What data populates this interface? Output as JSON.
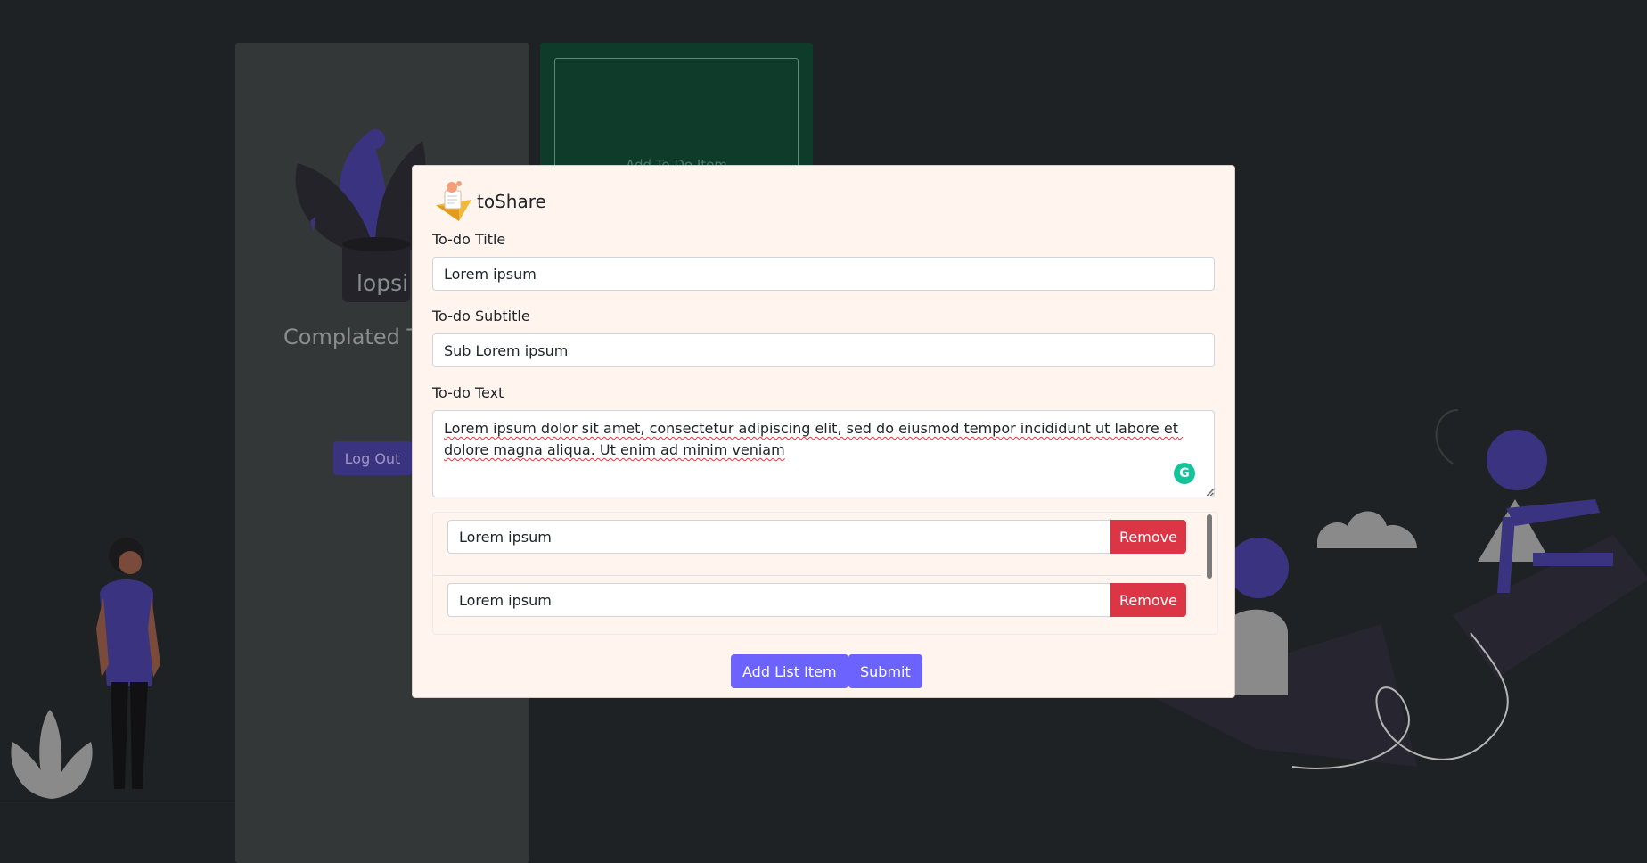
{
  "background": {
    "profile_name": "lopsi",
    "completed_label": "Complated To",
    "logout_label": "Log Out",
    "add_todo_label": "Add To Do Item"
  },
  "modal": {
    "brand": "toShare",
    "title_label": "To-do Title",
    "title_value": "Lorem ipsum",
    "subtitle_label": "To-do Subtitle",
    "subtitle_value": "Sub Lorem ipsum",
    "text_label": "To-do Text",
    "text_value": "Lorem ipsum dolor sit amet, consectetur adipiscing elit, sed do eiusmod tempor incididunt ut labore et dolore magna aliqua. Ut enim ad minim veniam",
    "list_items": [
      {
        "value": "Lorem ipsum",
        "remove_label": "Remove"
      },
      {
        "value": "Lorem ipsum",
        "remove_label": "Remove"
      }
    ],
    "add_list_item_label": "Add List Item",
    "submit_label": "Submit"
  },
  "colors": {
    "page_bg": "#1f2224",
    "modal_bg": "#fff4ee",
    "primary": "#6c63ff",
    "danger": "#dc3545",
    "todo_card": "#0f3b2a"
  }
}
